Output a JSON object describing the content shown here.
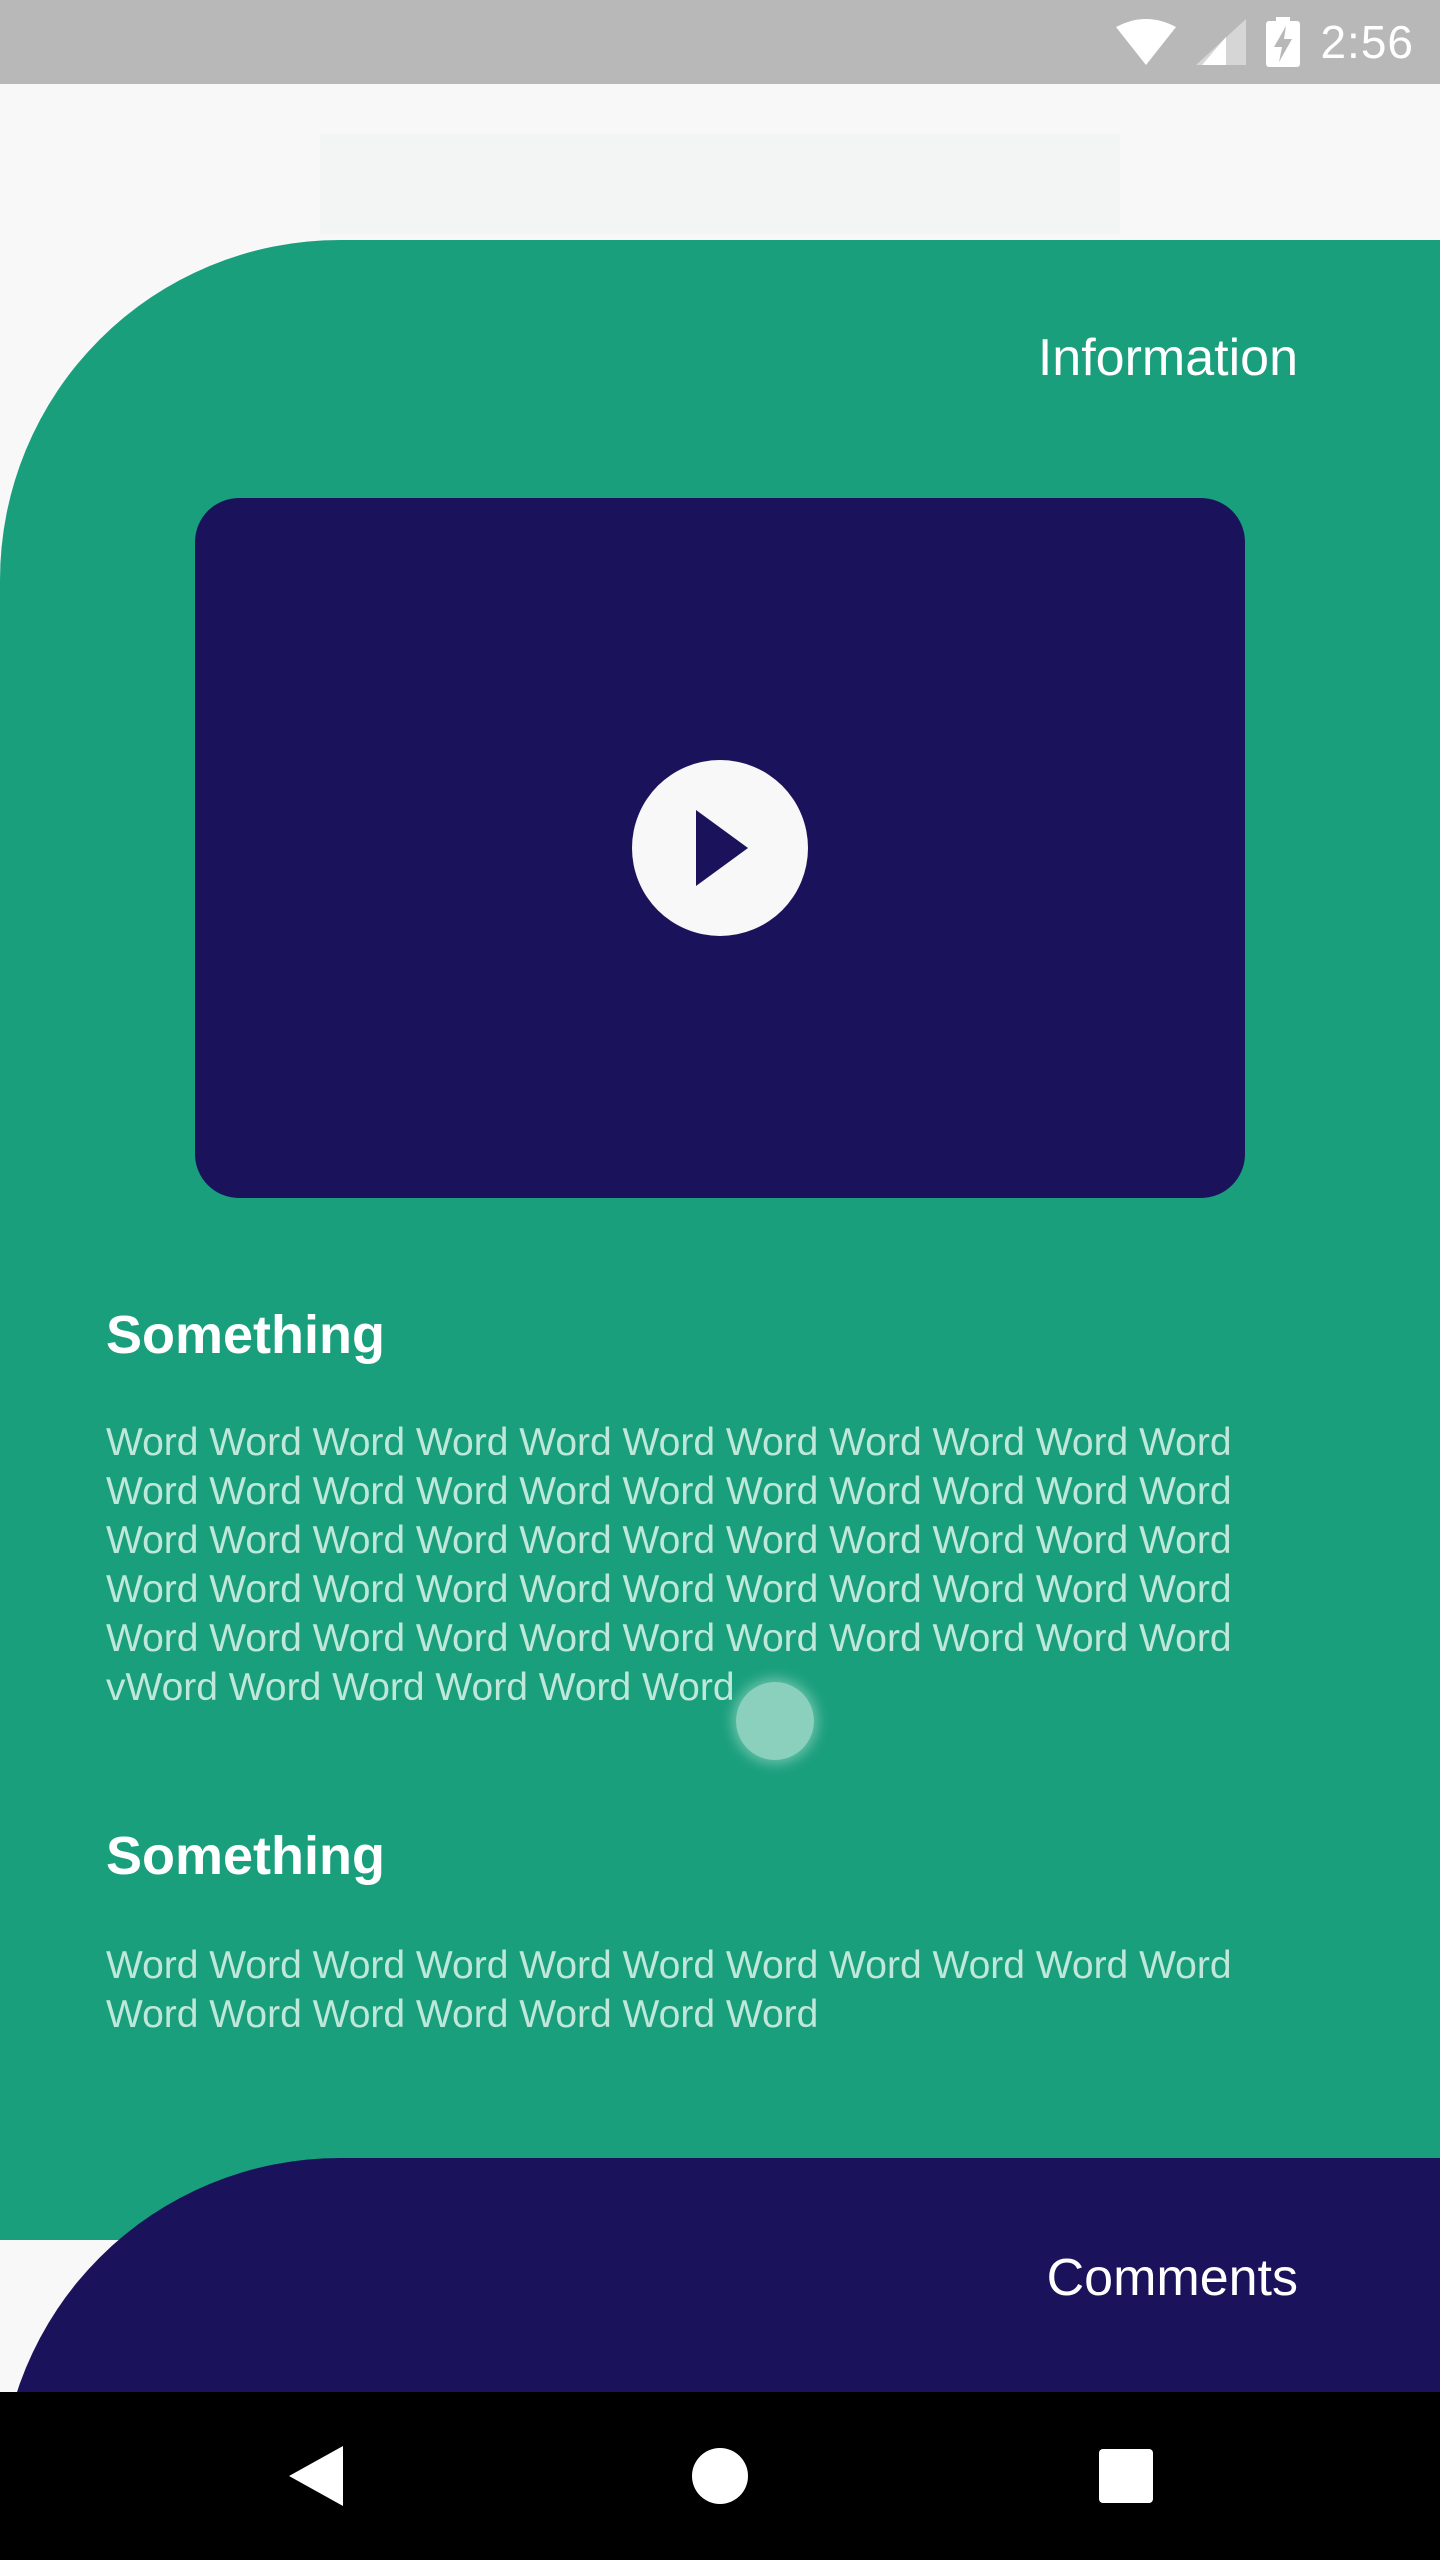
{
  "status_bar": {
    "time": "2:56",
    "icons": [
      "wifi-icon",
      "cell-signal-icon",
      "battery-charging-icon"
    ]
  },
  "information": {
    "title": "Information",
    "video": {
      "icon": "play-icon"
    },
    "sections": [
      {
        "heading": "Something",
        "body": "Word Word Word Word Word Word Word Word Word Word Word\nWord Word Word Word Word Word Word Word Word Word Word\nWord Word Word Word Word Word Word Word Word Word Word\nWord Word Word Word Word Word Word Word Word Word Word\nWord Word Word Word Word Word Word Word Word Word Word\nvWord Word Word Word Word Word"
      },
      {
        "heading": "Something",
        "body": "Word Word Word Word Word Word Word Word Word Word Word\nWord Word Word Word Word Word Word"
      }
    ]
  },
  "comments": {
    "title": "Comments"
  },
  "navigation": {
    "icons": [
      "back-icon",
      "home-icon",
      "recents-icon"
    ]
  },
  "colors": {
    "accent_green": "#1a9f7d",
    "navy": "#1a135c",
    "status_bar": "#b8b8b8",
    "background": "#f8f8f8"
  }
}
